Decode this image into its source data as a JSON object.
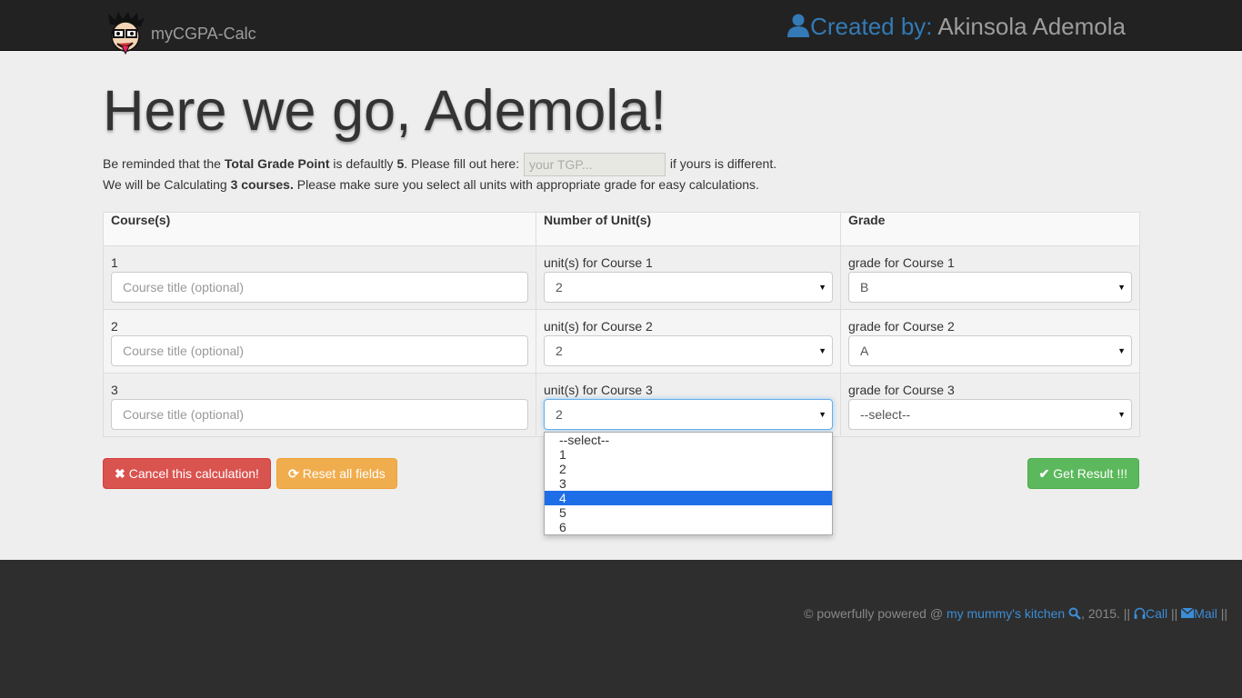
{
  "header": {
    "brand": "myCGPA-Calc",
    "created_label": "Created by:",
    "author": "Akinsola Ademola"
  },
  "main": {
    "headline": "Here we go, Ademola!",
    "reminder_prefix": "Be reminded that the ",
    "reminder_bold": "Total Grade Point",
    "reminder_mid": " is defaultly ",
    "default_tgp": "5",
    "reminder_suffix": ". Please fill out here:",
    "tgp_placeholder": "your TGP...",
    "reminder_end": "if yours is different.",
    "calc_prefix": "We will be Calculating ",
    "calc_bold": "3 courses.",
    "calc_suffix": " Please make sure you select all units with appropriate grade for easy calculations."
  },
  "table": {
    "headers": [
      "Course(s)",
      "Number of Unit(s)",
      "Grade"
    ],
    "rows": [
      {
        "num": "1",
        "title_placeholder": "Course title (optional)",
        "unit_label": "unit(s) for Course 1",
        "unit_value": "2",
        "grade_label": "grade for Course 1",
        "grade_value": "B"
      },
      {
        "num": "2",
        "title_placeholder": "Course title (optional)",
        "unit_label": "unit(s) for Course 2",
        "unit_value": "2",
        "grade_label": "grade for Course 2",
        "grade_value": "A"
      },
      {
        "num": "3",
        "title_placeholder": "Course title (optional)",
        "unit_label": "unit(s) for Course 3",
        "unit_value": "2",
        "grade_label": "grade for Course 3",
        "grade_value": "--select--"
      }
    ]
  },
  "dropdown": {
    "options": [
      "--select--",
      "1",
      "2",
      "3",
      "4",
      "5",
      "6"
    ],
    "highlighted": "4"
  },
  "buttons": {
    "cancel": "Cancel this calculation!",
    "reset": "Reset all fields",
    "result": "Get Result !!!"
  },
  "footer": {
    "prefix": "© powerfully powered @ ",
    "link": "my mummy's kitchen",
    "year": ", 2015. || ",
    "call": "Call",
    "sep": " || ",
    "mail": "Mail",
    "end": " ||"
  },
  "colors": {
    "navbar": "#222222",
    "link": "#337ab7",
    "danger": "#d9534f",
    "warning": "#f0ad4e",
    "success": "#5cb85c",
    "highlight": "#1e6ee8"
  },
  "icons": [
    "avatar-cartoon",
    "user-icon",
    "times-icon",
    "refresh-icon",
    "check-icon",
    "search-icon",
    "headphones-icon",
    "envelope-icon",
    "caret-down-icon"
  ]
}
